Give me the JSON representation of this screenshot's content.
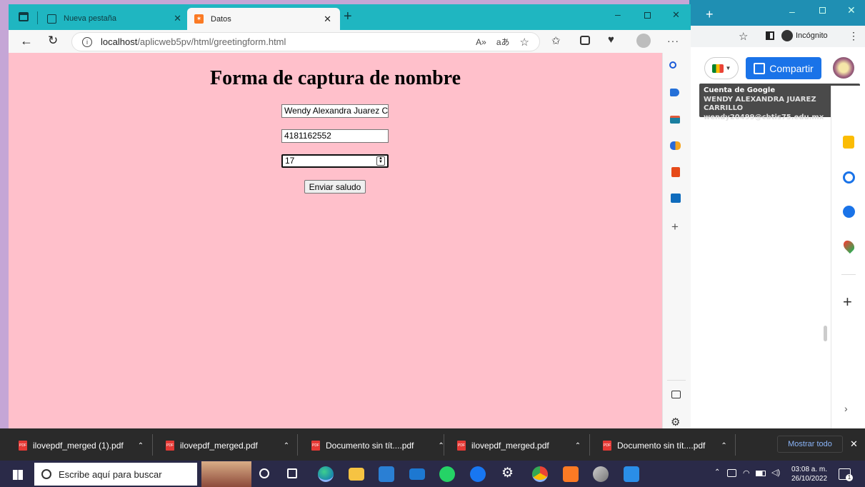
{
  "edge": {
    "tabs": [
      {
        "label": "Nueva pestaña"
      },
      {
        "label": "Datos"
      }
    ],
    "address": {
      "host": "localhost",
      "path": "/aplicweb5pv/html/greetingform.html"
    }
  },
  "page": {
    "title": "Forma de captura de nombre",
    "form": {
      "name_value": "Wendy Alexandra Juarez C",
      "phone_value": "4181162552",
      "age_value": "17",
      "submit_label": "Enviar saludo"
    }
  },
  "chrome_bg": {
    "incognito_label": "Incógnito",
    "share_label": "Compartir",
    "account_tooltip": {
      "heading": "Cuenta de Google",
      "name": "WENDY ALEXANDRA JUAREZ CARRILLO",
      "email": "wendy20499@cbtis75.edu.mx"
    }
  },
  "downloads": {
    "items": [
      {
        "name": "ilovepdf_merged (1).pdf"
      },
      {
        "name": "ilovepdf_merged.pdf"
      },
      {
        "name": "Documento sin tít....pdf"
      },
      {
        "name": "ilovepdf_merged.pdf"
      },
      {
        "name": "Documento sin tít....pdf"
      }
    ],
    "show_all_label": "Mostrar todo",
    "pdf_badge": "PDF"
  },
  "taskbar": {
    "search_placeholder": "Escribe aquí para buscar",
    "time": "03:08 a. m.",
    "date": "26/10/2022",
    "notification_count": "1"
  },
  "icons": {
    "read_aloud_glyph": "A»",
    "translate_glyph": "aあ"
  },
  "colors": {
    "page_bg": "#ffc0cb",
    "edge_titlebar": "#1fb6c1",
    "taskbar": "#2a2a48",
    "share_button": "#1a73e8"
  }
}
